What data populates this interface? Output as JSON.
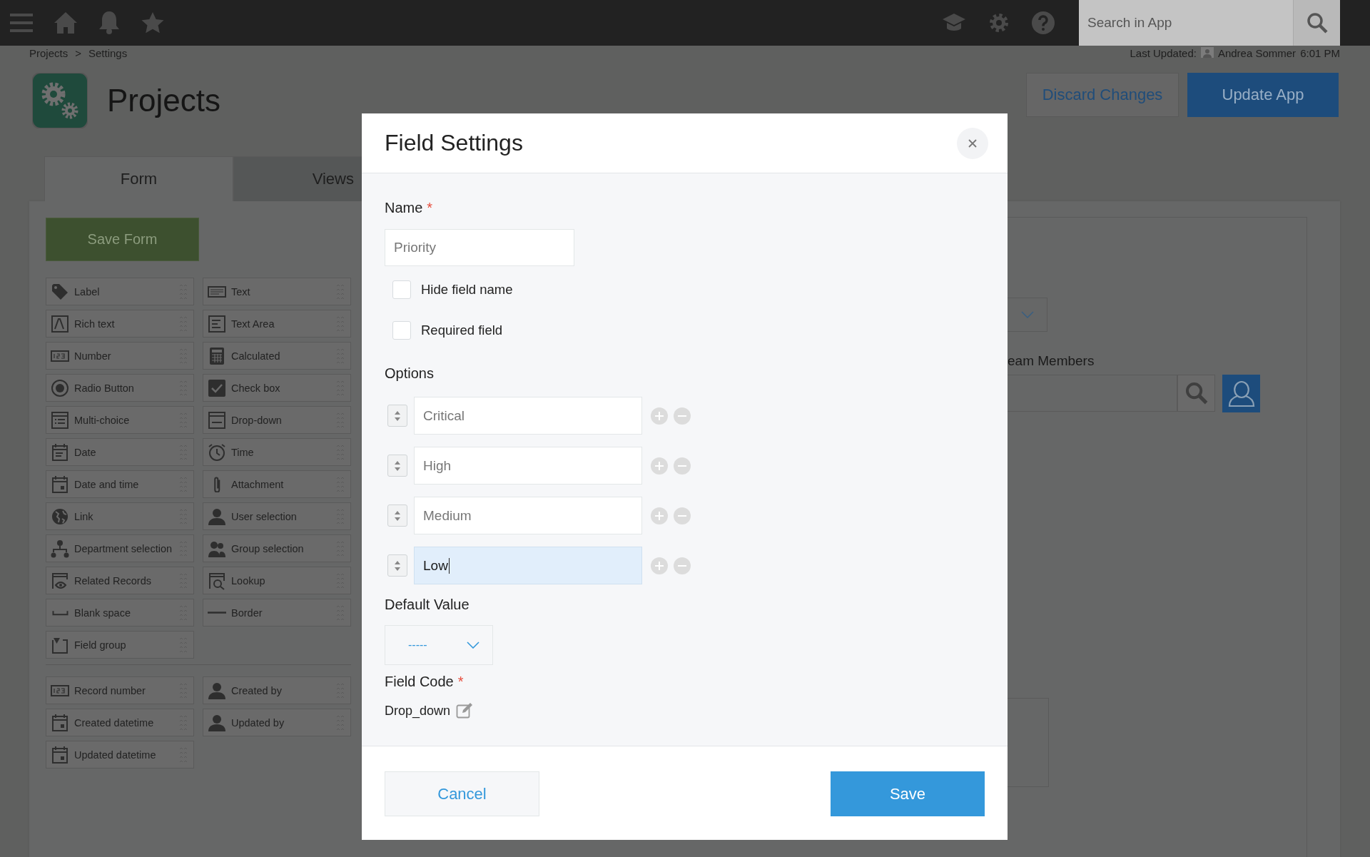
{
  "top_bar": {
    "search": {
      "placeholder": "Search in App"
    }
  },
  "breadcrumb": {
    "items": [
      "Projects",
      "Settings"
    ],
    "separator": ">"
  },
  "last_updated": {
    "label": "Last Updated:",
    "user": "Andrea Sommer",
    "time": "6:01 PM"
  },
  "app": {
    "title": "Projects"
  },
  "header_buttons": {
    "discard": "Discard Changes",
    "update": "Update App"
  },
  "tabs": [
    {
      "label": "Form",
      "selected": true
    },
    {
      "label": "Views",
      "selected": false
    }
  ],
  "save_form": "Save Form",
  "palette": [
    {
      "label": "Label",
      "kind": "label"
    },
    {
      "label": "Text",
      "kind": "text"
    },
    {
      "label": "Rich text",
      "kind": "richtext"
    },
    {
      "label": "Text Area",
      "kind": "textarea"
    },
    {
      "label": "Number",
      "kind": "number"
    },
    {
      "label": "Calculated",
      "kind": "calculated"
    },
    {
      "label": "Radio Button",
      "kind": "radio"
    },
    {
      "label": "Check box",
      "kind": "checkbox"
    },
    {
      "label": "Multi-choice",
      "kind": "multichoice"
    },
    {
      "label": "Drop-down",
      "kind": "dropdown"
    },
    {
      "label": "Date",
      "kind": "date"
    },
    {
      "label": "Time",
      "kind": "time"
    },
    {
      "label": "Date and time",
      "kind": "datetime"
    },
    {
      "label": "Attachment",
      "kind": "attachment"
    },
    {
      "label": "Link",
      "kind": "link"
    },
    {
      "label": "User selection",
      "kind": "user"
    },
    {
      "label": "Department selection",
      "kind": "department"
    },
    {
      "label": "Group selection",
      "kind": "group"
    },
    {
      "label": "Related Records",
      "kind": "related"
    },
    {
      "label": "Lookup",
      "kind": "lookup"
    },
    {
      "label": "Blank space",
      "kind": "blank"
    },
    {
      "label": "Border",
      "kind": "border"
    },
    {
      "label": "Field group",
      "kind": "fieldgroup"
    }
  ],
  "system_fields": [
    {
      "label": "Record number",
      "kind": "number"
    },
    {
      "label": "Created by",
      "kind": "user"
    },
    {
      "label": "Created datetime",
      "kind": "datetime"
    },
    {
      "label": "Updated by",
      "kind": "user"
    },
    {
      "label": "Updated datetime",
      "kind": "datetime"
    }
  ],
  "form_preview": {
    "field_label": "eam Members"
  },
  "modal": {
    "title": "Field Settings",
    "name": {
      "label": "Name",
      "required_mark": "*",
      "value": "Priority"
    },
    "checkboxes": [
      {
        "label": "Hide field name",
        "checked": false
      },
      {
        "label": "Required field",
        "checked": false
      }
    ],
    "options_label": "Options",
    "options": [
      {
        "value": "Critical",
        "focused": false
      },
      {
        "value": "High",
        "focused": false
      },
      {
        "value": "Medium",
        "focused": false
      },
      {
        "value": "Low",
        "focused": true
      }
    ],
    "default_value": {
      "label": "Default Value",
      "value": "-----"
    },
    "field_code": {
      "label": "Field Code",
      "required_mark": "*",
      "value": "Drop_down"
    },
    "cancel": "Cancel",
    "save": "Save"
  }
}
